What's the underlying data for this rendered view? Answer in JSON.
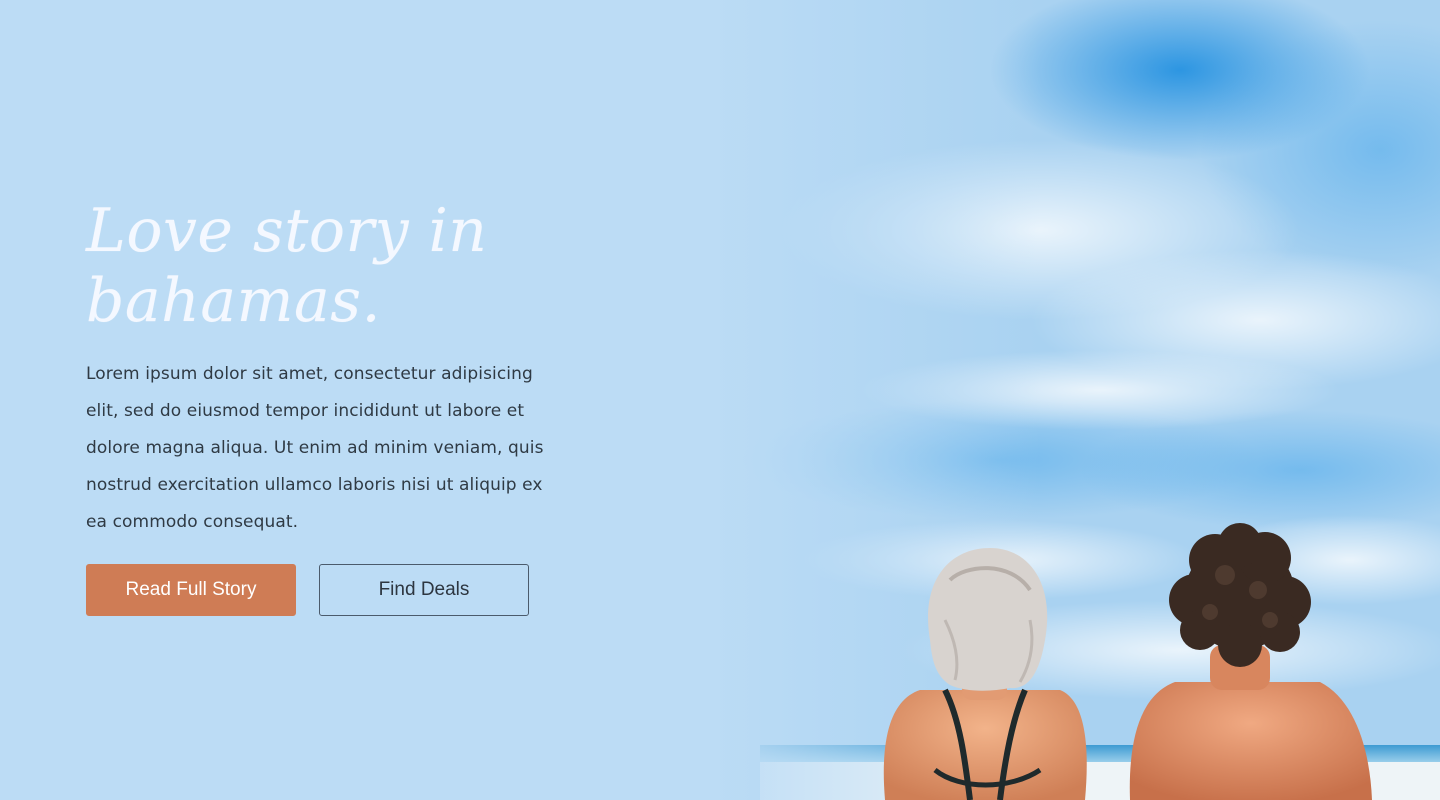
{
  "hero": {
    "headline": "Love story in bahamas.",
    "paragraph": "Lorem ipsum dolor sit amet, consectetur adipisicing elit, sed do eiusmod tempor incididunt ut labore et dolore magna aliqua. Ut enim ad minim veniam, quis nostrud exercitation ullamco laboris nisi ut aliquip ex ea commodo consequat.",
    "primary_button": "Read Full Story",
    "secondary_button": "Find Deals"
  },
  "colors": {
    "background": "#bcdcf5",
    "headline": "#f4f8ff",
    "body_text": "#2f3a44",
    "primary_button": "#cf7c55",
    "secondary_border": "#4b5b6c"
  }
}
